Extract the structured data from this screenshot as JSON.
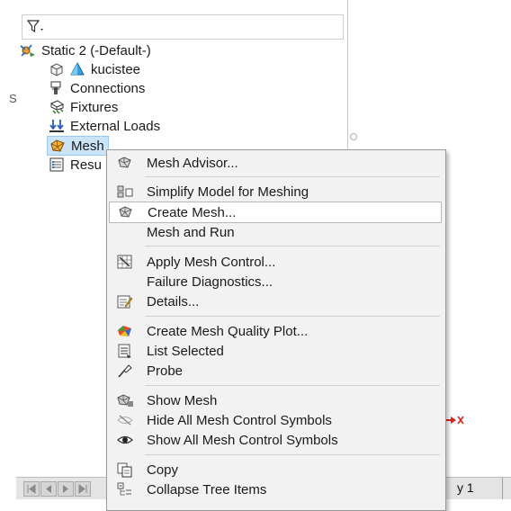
{
  "tree": {
    "root_label": "Static 2 (-Default-)",
    "items": [
      {
        "label": "kucistee",
        "icon": "part-body-icon"
      },
      {
        "label": "Connections",
        "icon": "connections-icon"
      },
      {
        "label": "Fixtures",
        "icon": "fixtures-icon"
      },
      {
        "label": "External Loads",
        "icon": "external-loads-icon"
      },
      {
        "label": "Mesh",
        "icon": "mesh-icon"
      },
      {
        "label": "Resu",
        "icon": "results-icon"
      }
    ],
    "left_letter": "S"
  },
  "context_menu": {
    "items": [
      {
        "label": "Mesh Advisor...",
        "icon": "mesh-advisor-icon"
      },
      {
        "label": "Simplify Model for Meshing",
        "icon": "simplify-model-icon"
      },
      {
        "label": "Create Mesh...",
        "icon": "create-mesh-icon"
      },
      {
        "label": "Mesh and Run",
        "icon": ""
      },
      {
        "label": "Apply Mesh Control...",
        "icon": "apply-mesh-control-icon"
      },
      {
        "label": "Failure Diagnostics...",
        "icon": ""
      },
      {
        "label": "Details...",
        "icon": "details-icon"
      },
      {
        "label": "Create Mesh Quality Plot...",
        "icon": "mesh-quality-plot-icon"
      },
      {
        "label": "List Selected",
        "icon": "list-selected-icon"
      },
      {
        "label": "Probe",
        "icon": "probe-icon"
      },
      {
        "label": "Show Mesh",
        "icon": "show-mesh-icon"
      },
      {
        "label": "Hide All Mesh Control Symbols",
        "icon": "hide-symbols-icon"
      },
      {
        "label": "Show All Mesh Control Symbols",
        "icon": "show-symbols-icon"
      },
      {
        "label": "Copy",
        "icon": "copy-icon"
      },
      {
        "label": "Collapse Tree Items",
        "icon": "collapse-tree-icon"
      }
    ]
  },
  "status_bar": {
    "sheet_label": "y 1"
  },
  "colors": {
    "selection_bg": "#cce4f7",
    "menu_bg": "#f2f2f2",
    "accent_red": "#d9251d"
  }
}
